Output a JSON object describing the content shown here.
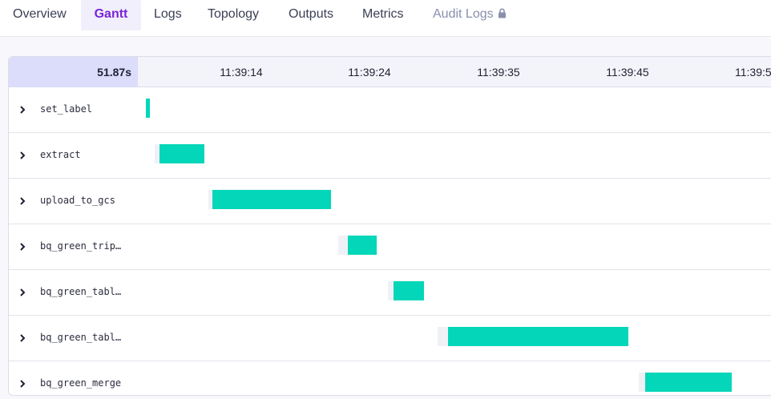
{
  "tabs": [
    {
      "label": "Overview",
      "state": "normal"
    },
    {
      "label": "Gantt",
      "state": "active"
    },
    {
      "label": "Logs",
      "state": "normal"
    },
    {
      "label": "Topology",
      "state": "normal"
    },
    {
      "label": "Outputs",
      "state": "normal"
    },
    {
      "label": "Metrics",
      "state": "normal"
    },
    {
      "label": "Audit Logs",
      "state": "disabled",
      "icon": "lock-icon"
    }
  ],
  "gantt": {
    "duration": "51.87s",
    "ticks": [
      "11:39:14",
      "11:39:24",
      "11:39:35",
      "11:39:45",
      "11:39:5"
    ],
    "tasks": [
      {
        "label": "set_label"
      },
      {
        "label": "extract"
      },
      {
        "label": "upload_to_gcs"
      },
      {
        "label": "bq_green_trip…"
      },
      {
        "label": "bq_green_tabl…"
      },
      {
        "label": "bq_green_tabl…"
      },
      {
        "label": "bq_green_merge"
      }
    ]
  },
  "colors": {
    "accent": "#7a24d6",
    "bar": "#03d6b9",
    "duration_bg": "#dcdcfb"
  }
}
